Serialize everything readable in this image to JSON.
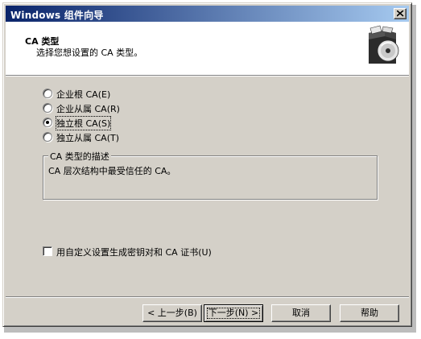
{
  "window": {
    "title": "Windows 组件向导",
    "close_glyph": "×"
  },
  "header": {
    "title": "CA 类型",
    "subtitle": "选择您想设置的 CA 类型。",
    "icon": "wizard-box-cd-icon"
  },
  "ca_types": [
    {
      "label": "企业根 CA(E)",
      "checked": false
    },
    {
      "label": "企业从属 CA(R)",
      "checked": false
    },
    {
      "label": "独立根 CA(S)",
      "checked": true
    },
    {
      "label": "独立从属 CA(T)",
      "checked": false
    }
  ],
  "description": {
    "legend": "CA 类型的描述",
    "text": "CA 层次结构中最受信任的 CA。"
  },
  "custom_settings": {
    "label": "用自定义设置生成密钥对和 CA 证书(U)",
    "checked": false
  },
  "buttons": {
    "back": "< 上一步(B)",
    "next": "下一步(N) >",
    "cancel": "取消",
    "help": "帮助"
  }
}
